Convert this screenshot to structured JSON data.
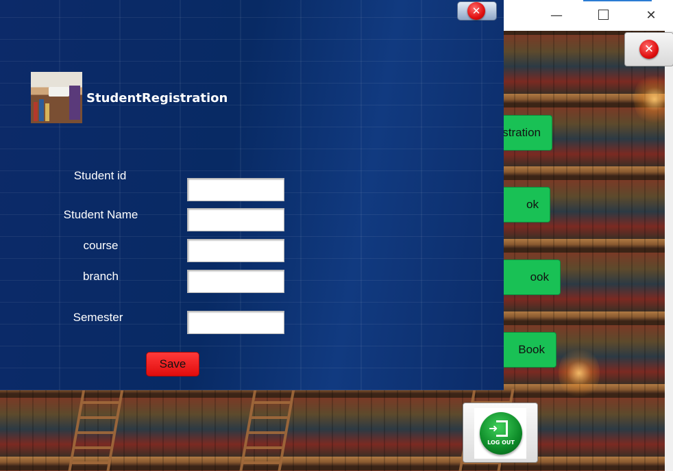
{
  "dialog": {
    "title": "StudentRegistration",
    "close_icon": "close-icon",
    "logo_icon": "library-books-logo",
    "fields": {
      "student_id": {
        "label": "Student id",
        "value": ""
      },
      "student_name": {
        "label": "Student Name",
        "value": ""
      },
      "course": {
        "label": "course",
        "value": ""
      },
      "branch": {
        "label": "branch",
        "value": ""
      },
      "semester": {
        "label": "Semester",
        "value": ""
      }
    },
    "save_label": "Save"
  },
  "main_window": {
    "title_controls": {
      "minimize": "—",
      "maximize": "",
      "close": "✕"
    },
    "buttons": {
      "registration": "stration",
      "book_1": "ok",
      "book_2": "ook",
      "book_3": "Book"
    },
    "exit_icon": "close-icon",
    "logout_label": "LOG OUT"
  },
  "colors": {
    "dialog_bg": "#0b2b67",
    "green_button": "#19c155",
    "save_button": "#e00c0c",
    "close_red": "#e01010"
  }
}
